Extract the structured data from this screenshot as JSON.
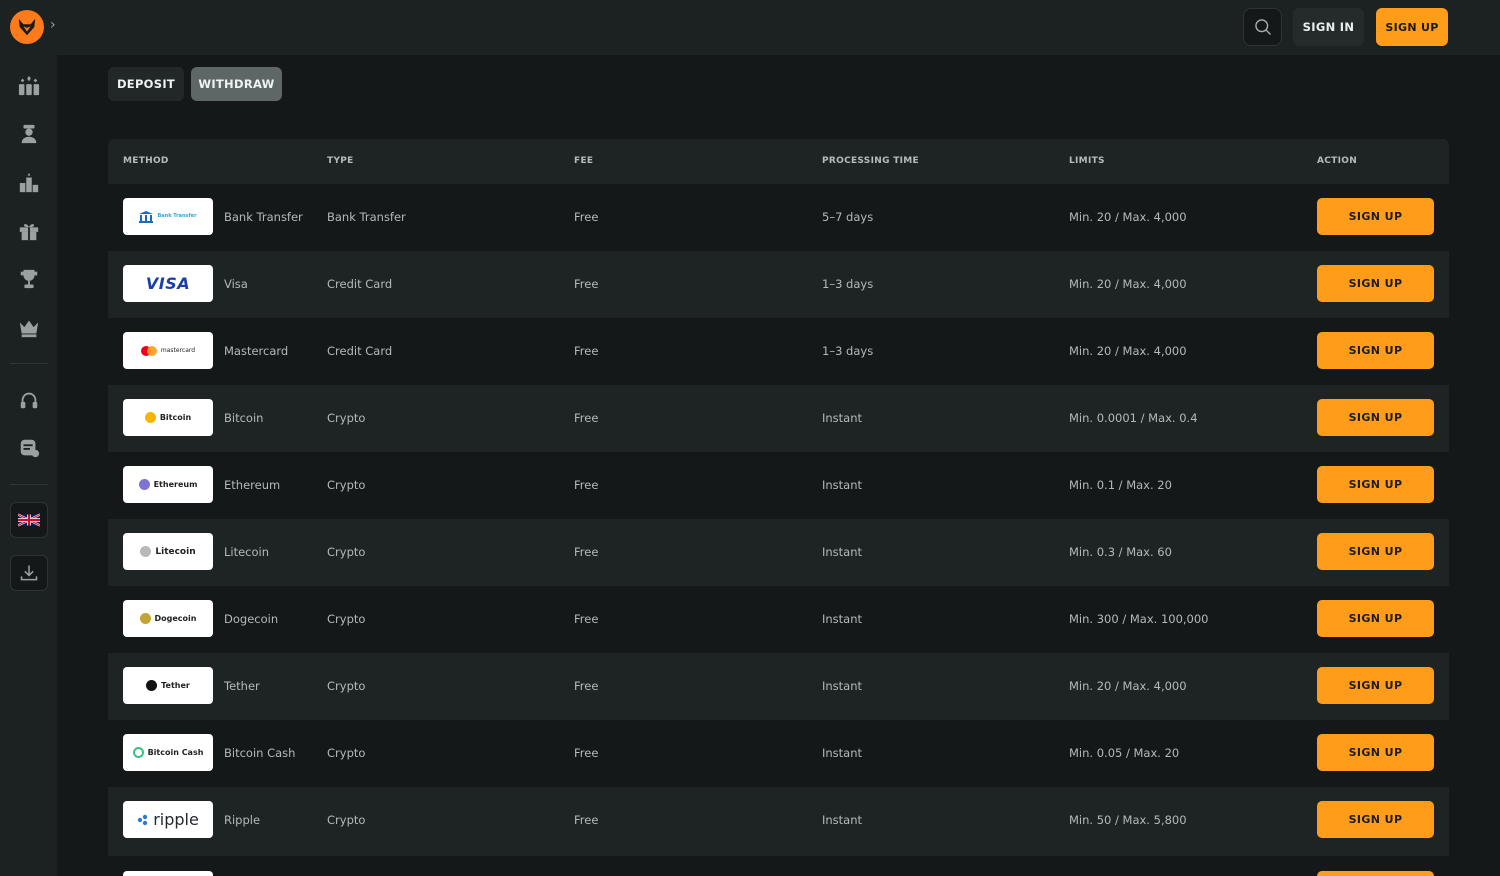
{
  "header": {
    "signin_label": "SIGN IN",
    "signup_label": "SIGN UP"
  },
  "tabs": [
    {
      "label": "DEPOSIT"
    },
    {
      "label": "WITHDRAW",
      "active": true
    }
  ],
  "table": {
    "headers": [
      "METHOD",
      "TYPE",
      "FEE",
      "PROCESSING TIME",
      "LIMITS",
      "ACTION"
    ],
    "rows": [
      {
        "logo": "Bank Transfer",
        "name": "Bank Transfer",
        "type": "Bank Transfer",
        "fee": "Free",
        "processing": "5–7 days",
        "limits": "Min. 20 / Max. 4,000",
        "action": "SIGN UP"
      },
      {
        "logo": "VISA",
        "name": "Visa",
        "type": "Credit Card",
        "fee": "Free",
        "processing": "1–3 days",
        "limits": "Min. 20 / Max. 4,000",
        "action": "SIGN UP"
      },
      {
        "logo": "mastercard",
        "name": "Mastercard",
        "type": "Credit Card",
        "fee": "Free",
        "processing": "1–3 days",
        "limits": "Min. 20 / Max. 4,000",
        "action": "SIGN UP"
      },
      {
        "logo": "Bitcoin",
        "name": "Bitcoin",
        "type": "Crypto",
        "fee": "Free",
        "processing": "Instant",
        "limits": "Min. 0.0001 / Max. 0.4",
        "action": "SIGN UP"
      },
      {
        "logo": "Ethereum",
        "name": "Ethereum",
        "type": "Crypto",
        "fee": "Free",
        "processing": "Instant",
        "limits": "Min. 0.1 / Max. 20",
        "action": "SIGN UP"
      },
      {
        "logo": "Litecoin",
        "name": "Litecoin",
        "type": "Crypto",
        "fee": "Free",
        "processing": "Instant",
        "limits": "Min. 0.3 / Max. 60",
        "action": "SIGN UP"
      },
      {
        "logo": "Dogecoin",
        "name": "Dogecoin",
        "type": "Crypto",
        "fee": "Free",
        "processing": "Instant",
        "limits": "Min. 300 / Max. 100,000",
        "action": "SIGN UP"
      },
      {
        "logo": "Tether",
        "name": "Tether",
        "type": "Crypto",
        "fee": "Free",
        "processing": "Instant",
        "limits": "Min. 20 / Max. 4,000",
        "action": "SIGN UP"
      },
      {
        "logo": "Bitcoin Cash",
        "name": "Bitcoin Cash",
        "type": "Crypto",
        "fee": "Free",
        "processing": "Instant",
        "limits": "Min. 0.05 / Max. 20",
        "action": "SIGN UP"
      },
      {
        "logo": "ripple",
        "name": "Ripple",
        "type": "Crypto",
        "fee": "Free",
        "processing": "Instant",
        "limits": "Min. 50 / Max. 5,800",
        "action": "SIGN UP"
      }
    ]
  },
  "colors": {
    "accent": "#ff9d1b",
    "background": "#141818",
    "panel": "#1e2424"
  }
}
